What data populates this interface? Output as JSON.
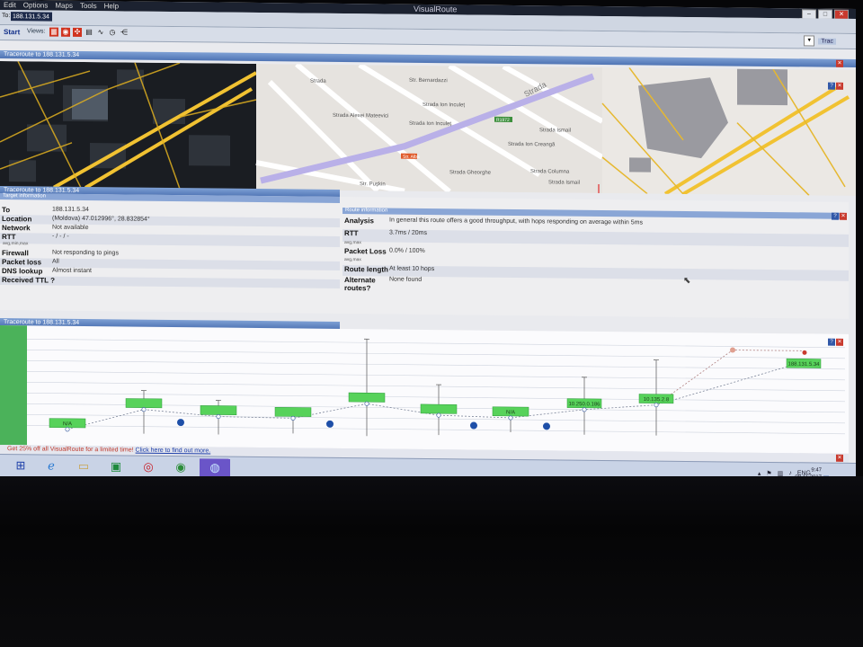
{
  "window": {
    "title": "VisualRoute",
    "menu": [
      "Edit",
      "Options",
      "Maps",
      "Tools",
      "Help"
    ],
    "buttons": {
      "minimize": "–",
      "maximize": "□",
      "close": "✕"
    }
  },
  "address": {
    "label": "To:",
    "value": "188.131.5.34"
  },
  "toolbar": {
    "start": "Start",
    "views": "Views:",
    "trace_label": "Trac"
  },
  "map_panel": {
    "title": "Traceroute to 188.131.5.34"
  },
  "map_labels": [
    "Strada",
    "Str. Bernardazzi",
    "Strada Alexei Mateevici",
    "Strada Ion Inculeț",
    "Strada Ion Inculeț",
    "Strada Ion Creangă",
    "Strada Gheorghe",
    "Strada Columna",
    "Strada Ismail",
    "Str. Pușkin",
    "R1972",
    "Str. Alba",
    "Strada Ismail"
  ],
  "trace_panel": {
    "title": "Traceroute to 188.131.5.34",
    "target_header": "Target information",
    "route_header": "Route information"
  },
  "target": {
    "to_label": "To",
    "to_value": "188.131.5.34",
    "location_label": "Location",
    "location_value": "(Moldova) 47.012996°, 28.832854°",
    "network_label": "Network",
    "network_value": "Not available",
    "rtt_label": "RTT",
    "rtt_value": "- / - / -",
    "rtt_sub": "avg,min,max",
    "firewall_label": "Firewall",
    "firewall_value": "Not responding to pings",
    "packet_loss_label": "Packet loss",
    "packet_loss_value": "All",
    "dns_label": "DNS lookup",
    "dns_value": "Almost instant",
    "ttl_label": "Received TTL ?"
  },
  "route": {
    "analysis_label": "Analysis",
    "analysis_value": "In general this route offers a good throughput, with hops responding on average within 5ms",
    "rtt_label": "RTT",
    "rtt_value": "3.7ms / 20ms",
    "rtt_sub": "avg,max",
    "loss_label": "Packet Loss",
    "loss_value": "0.0% / 100%",
    "loss_sub": "avg,max",
    "length_label": "Route length",
    "length_value": "At least 10 hops",
    "alternate_label": "Alternate routes?",
    "alternate_value": "None found"
  },
  "graph_panel": {
    "title": "Traceroute to 188.131.5.34"
  },
  "chart_data": {
    "type": "scatter",
    "title": "",
    "hop_labels": [
      "N/A",
      "",
      "",
      "",
      "",
      "",
      "N/A",
      "10.250.0.186",
      "10.135.2.8",
      "188.131.5.34"
    ]
  },
  "footer": {
    "promo": "Get 25% off all VisualRoute for a limited time!",
    "link": "Click here to find out more."
  },
  "taskbar": {
    "apps": [
      "start-icon",
      "ie-icon",
      "explorer-icon",
      "excel-icon",
      "opera-icon",
      "chrome-icon",
      "visualroute-icon"
    ],
    "tray_lang": "ENG",
    "clock_time": "9:47",
    "clock_date": "08.11.2017"
  },
  "colors": {
    "accent": "#4f74b4",
    "node": "#57d25a",
    "road": "#f1c232"
  }
}
